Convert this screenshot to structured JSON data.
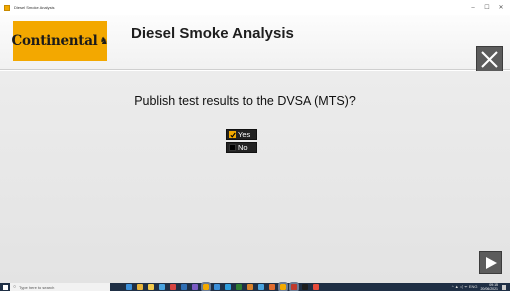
{
  "window": {
    "title": "Diesel Smoke Analysis",
    "minimize": "–",
    "maximize": "☐",
    "close": "✕"
  },
  "header": {
    "brand": "Continental",
    "brand_symbol": "♞",
    "title": "Diesel Smoke Analysis",
    "close_icon": "close-icon"
  },
  "main": {
    "question": "Publish test results to the DVSA (MTS)?",
    "options": [
      {
        "label": "Yes",
        "checked": true,
        "mark": "✔"
      },
      {
        "label": "No",
        "checked": false,
        "mark": ""
      }
    ],
    "next_icon": "play-arrow-icon"
  },
  "taskbar": {
    "search_placeholder": "Type here to search",
    "search_icon": "○",
    "app_icon_colors": [
      "#3b8fd9",
      "#e8b43a",
      "#f2c94c",
      "#4aa3df",
      "#d64541",
      "#2f6fb5",
      "#7b5cc4",
      "#f2a900",
      "#3b8fd9",
      "#2d9cdb",
      "#2e7d32",
      "#d9822b",
      "#4aa3df",
      "#e06c2e",
      "#f2a900",
      "#c0392b",
      "#1e1e1e",
      "#e74c3c"
    ],
    "active_app_indices": [
      7,
      14,
      15
    ],
    "tray_icons": "^ ▲ ◁ ᯤ ENG",
    "time": "09:15",
    "date": "20/06/2021"
  },
  "colors": {
    "accent": "#f2a900",
    "button_dark": "#5c5c5c",
    "taskbar": "#1f2f45"
  }
}
